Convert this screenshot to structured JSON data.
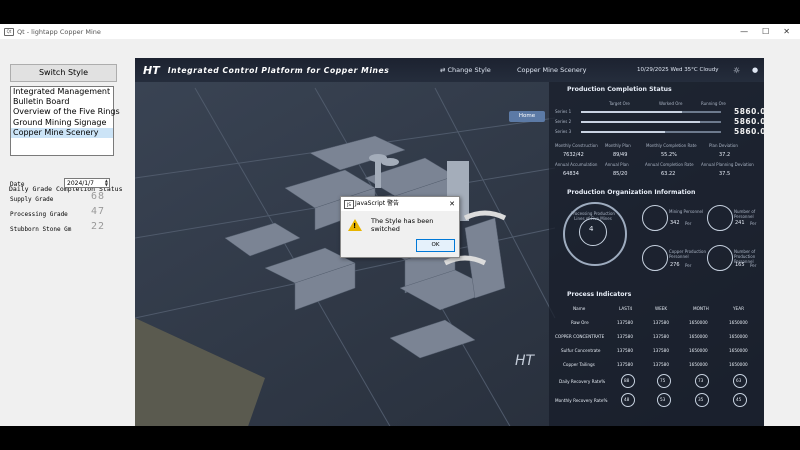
{
  "window": {
    "title": "Qt - lightapp Copper Mine",
    "controls": [
      "—",
      "☐",
      "✕"
    ]
  },
  "left_panel": {
    "switch_button": "Switch Style",
    "list_items": [
      "Integrated Management",
      "Bulletin Board",
      "Overview of the Five Rings",
      "Ground Mining Signage",
      "Copper Mine Scenery"
    ],
    "selected_index": 4,
    "daily_grade_title": "Daily Grade Completion Status",
    "date_label": "Date",
    "date_value": "2024/1/7",
    "supply_grade_label": "Supply Grade",
    "supply_grade_value": "68",
    "processing_grade_label": "Processing Grade",
    "processing_grade_value": "47",
    "stubborn_stone_label": "Stubborn Stone Gm",
    "stubborn_stone_value": "22"
  },
  "scene": {
    "logo": "HT",
    "title": "Integrated Control Platform for Copper Mines",
    "change_style": "⇄ Change Style",
    "style_name": "Copper Mine Scenery",
    "datetime_weather": "10/29/2025 Wed   35°C  Cloudy",
    "home_button": "Home",
    "production_completion": {
      "title": "Production Completion Status",
      "legend": [
        "Target Ore",
        "Worked Ore",
        "Running Ore"
      ],
      "series": [
        {
          "name": "Series 1",
          "value": "5860.0",
          "fraction": 0.72
        },
        {
          "name": "Series 2",
          "value": "5860.0",
          "fraction": 0.85
        },
        {
          "name": "Series 3",
          "value": "5860.0",
          "fraction": 0.6
        }
      ],
      "metrics_row1_labels": [
        "Monthly Construction",
        "Monthly Plan",
        "Monthly Completion Rate",
        "Plan Deviation"
      ],
      "metrics_row1_values": [
        "7632/42",
        "89/49",
        "55.2%",
        "37.2"
      ],
      "metrics_row2_labels": [
        "Annual Accumulation",
        "Annual Plan",
        "Annual Completion Rate",
        "Annual Planning Deviation"
      ],
      "metrics_row2_values": [
        "64834",
        "85/20",
        "63.22",
        "37.5"
      ]
    },
    "production_org": {
      "title": "Production Organization Information",
      "center_label": "Processing Production Lines of Five Mines",
      "center_value": "4",
      "nodes": [
        {
          "label": "Mining Personnel",
          "value": "342",
          "unit": "Per"
        },
        {
          "label": "Number of Personnel",
          "value": "241",
          "unit": "Per"
        },
        {
          "label": "Copper Production Personnel",
          "value": "276",
          "unit": "Per"
        },
        {
          "label": "Number of Production Personnel",
          "value": "165",
          "unit": "Per"
        }
      ]
    },
    "process_indicators": {
      "title": "Process Indicators",
      "columns": [
        "Name",
        "LAST4",
        "WEEK",
        "MONTH",
        "YEAR"
      ],
      "rows": [
        [
          "Raw Ore",
          "137580",
          "137580",
          "1650000",
          "1650000"
        ],
        [
          "COPPER CONCENTRATE",
          "137580",
          "137580",
          "1650000",
          "1650000"
        ],
        [
          "Sulfur Concentrate",
          "137580",
          "137580",
          "1650000",
          "1650000"
        ],
        [
          "Copper Tailings",
          "137580",
          "137580",
          "1650000",
          "1650000"
        ]
      ],
      "daily_recovery_label": "Daily Recovery Rate%",
      "daily_recovery_values": [
        "88",
        "75",
        "73",
        "63"
      ],
      "monthly_recovery_label": "Monthly Recovery Rate%",
      "monthly_recovery_values": [
        "48",
        "53",
        "35",
        "45"
      ]
    }
  },
  "dialog": {
    "title": "JavaScript 警告",
    "message": "The Style has been switched",
    "ok_label": "OK"
  }
}
